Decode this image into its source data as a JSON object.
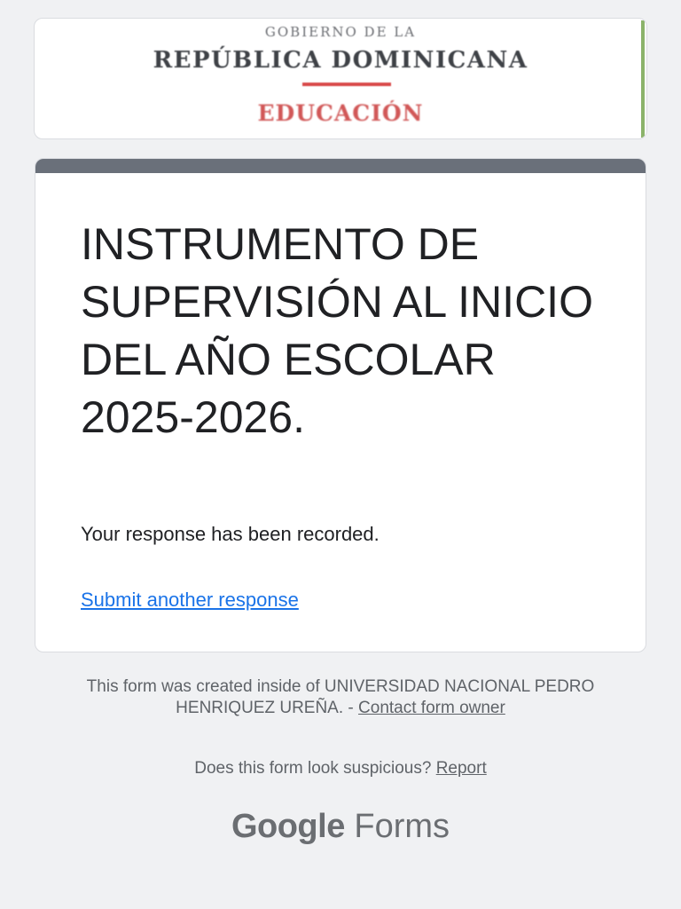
{
  "header": {
    "logo_line1": "GOBIERNO DE LA",
    "logo_line2": "REPÚBLICA DOMINICANA",
    "logo_line3": "EDUCACIÓN"
  },
  "form": {
    "title": "INSTRUMENTO DE SUPERVISIÓN AL INICIO DEL AÑO ESCOLAR 2025-2026.",
    "confirmation": "Your response has been recorded.",
    "submit_another": "Submit another response"
  },
  "footer": {
    "created_text": "This form was created inside of UNIVERSIDAD NACIONAL PEDRO HENRIQUEZ UREÑA. -",
    "contact_link": "Contact form owner",
    "suspicious_text": "Does this form look suspicious?",
    "report_link": "Report",
    "brand_google": "Google",
    "brand_forms": "Forms"
  },
  "colors": {
    "background": "#f0f1f3",
    "accent_bar": "#6a707a",
    "link": "#1a73e8",
    "logo_red": "#d15858",
    "logo_green": "#8bb36a"
  }
}
